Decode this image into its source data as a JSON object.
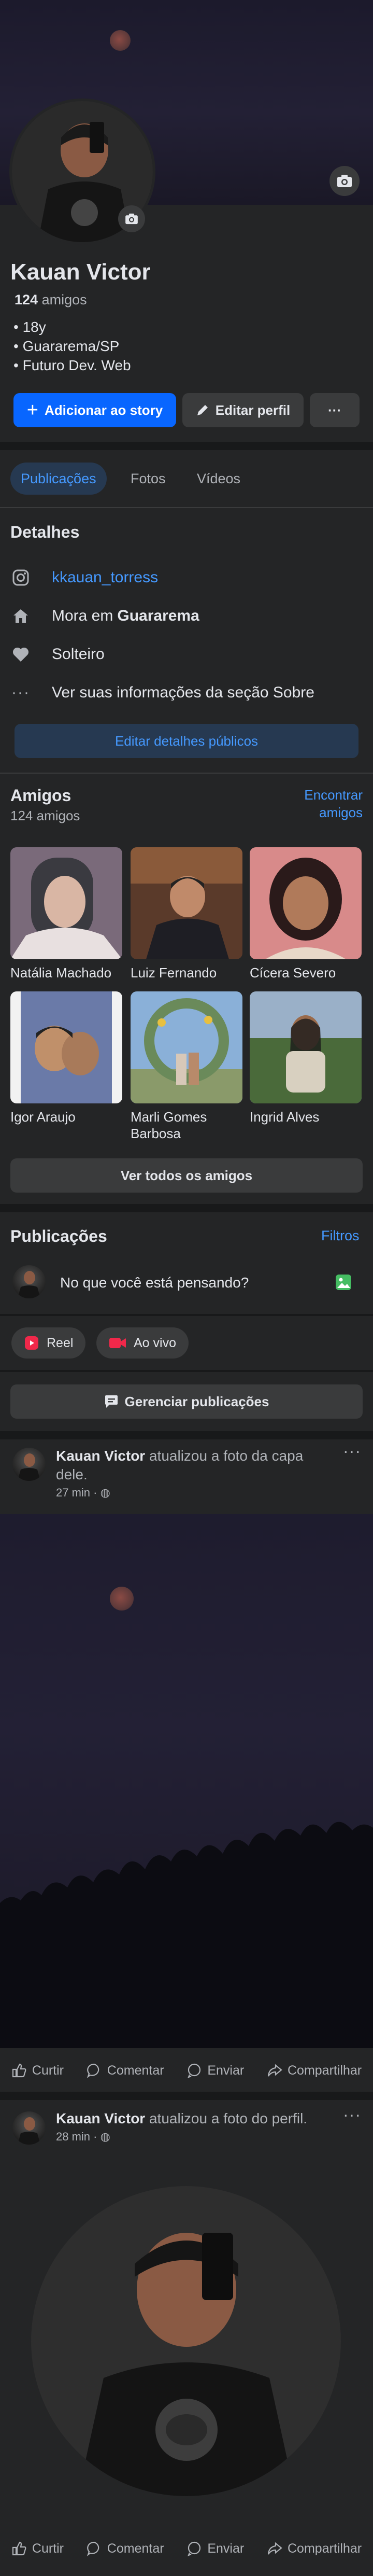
{
  "profile": {
    "name": "Kauan Victor",
    "friends_count": "124",
    "friends_suffix": "amigos",
    "bio": [
      "• 18y",
      "• Guararema/SP",
      "• Futuro Dev. Web"
    ],
    "add_story_label": "Adicionar ao story",
    "edit_profile_label": "Editar perfil",
    "more_label": "···"
  },
  "tabs": [
    "Publicações",
    "Fotos",
    "Vídeos"
  ],
  "details": {
    "title": "Detalhes",
    "instagram": "kkauan_torress",
    "lives_prefix": "Mora em ",
    "lives_city": "Guararema",
    "relationship": "Solteiro",
    "about_link": "Ver suas informações da seção Sobre",
    "edit_public_label": "Editar detalhes públicos"
  },
  "friends": {
    "title": "Amigos",
    "count_label": "124 amigos",
    "find_label": "Encontrar amigos",
    "list": [
      {
        "name": "Natália Machado"
      },
      {
        "name": "Luiz Fernando"
      },
      {
        "name": "Cícera Severo"
      },
      {
        "name": "Igor Araujo"
      },
      {
        "name": "Marli Gomes Barbosa"
      },
      {
        "name": "Ingrid Alves"
      }
    ],
    "see_all_label": "Ver todos os amigos"
  },
  "posts_section": {
    "title": "Publicações",
    "filters_label": "Filtros",
    "composer_placeholder": "No que você está pensando?",
    "reel_label": "Reel",
    "live_label": "Ao vivo",
    "manage_label": "Gerenciar publicações"
  },
  "posts": [
    {
      "author": "Kauan Victor",
      "action": " atualizou a foto da capa dele.",
      "time": "27 min · "
    },
    {
      "author": "Kauan Victor",
      "action": " atualizou a foto do perfil.",
      "time": "28 min · "
    }
  ],
  "post_actions": {
    "like": "Curtir",
    "comment": "Comentar",
    "send": "Enviar",
    "share": "Compartilhar"
  },
  "colors": {
    "accent": "#4599ff",
    "primary_button": "#0866ff",
    "background": "#242526",
    "surface": "#3a3b3c"
  }
}
